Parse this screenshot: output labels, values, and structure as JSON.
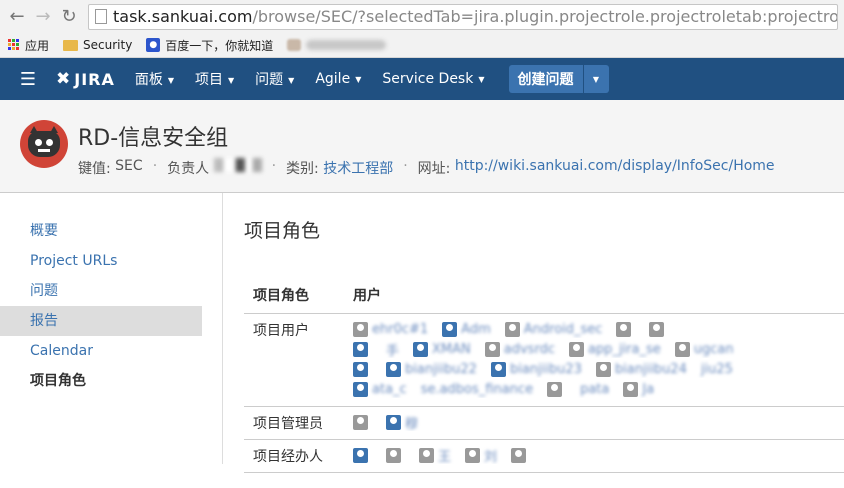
{
  "browser": {
    "url_host": "task.sankuai.com",
    "url_path": "/browse/SEC/?selectedTab=jira.plugin.projectrole.projectroletab:projectroletab",
    "bookmarks": [
      {
        "label": "应用",
        "icon": "apps-icon"
      },
      {
        "label": "Security",
        "icon": "folder-icon"
      },
      {
        "label": "百度一下，你就知道",
        "icon": "baidu-paw-icon"
      }
    ]
  },
  "header": {
    "logo": "JIRA",
    "menu": [
      {
        "label": "面板"
      },
      {
        "label": "项目"
      },
      {
        "label": "问题"
      },
      {
        "label": "Agile"
      },
      {
        "label": "Service Desk"
      }
    ],
    "create_label": "创建问题",
    "brand_color": "#205081"
  },
  "project": {
    "title": "RD-信息安全组",
    "key_label": "键值:",
    "key": "SEC",
    "lead_label": "负责人",
    "category_label": "类别:",
    "category": "技术工程部",
    "url_label": "网址:",
    "url": "http://wiki.sankuai.com/display/InfoSec/Home"
  },
  "sidebar": {
    "items": [
      {
        "label": "概要"
      },
      {
        "label": "Project URLs"
      },
      {
        "label": "问题"
      },
      {
        "label": "报告"
      },
      {
        "label": "Calendar"
      },
      {
        "label": "项目角色"
      }
    ]
  },
  "main": {
    "title": "项目角色",
    "col_role": "项目角色",
    "col_users": "用户",
    "rows": [
      {
        "role": "项目用户",
        "user_lines": [
          [
            "ehr0c#1",
            "Adm",
            "Android_sec",
            "",
            ""
          ],
          [
            "",
            "手",
            "XMAN",
            "advsrdc",
            "app_jira_se",
            "ugcan"
          ],
          [
            "",
            "bianjiibu22",
            "bianjiibu23",
            "bianjiibu24",
            "jiu25"
          ],
          [
            "ata_c",
            "se.adbos_finance",
            "",
            "pata",
            "Ja"
          ]
        ]
      },
      {
        "role": "项目管理员",
        "user_lines": [
          [
            "",
            "穆"
          ]
        ]
      },
      {
        "role": "项目经办人",
        "user_lines": [
          [
            "",
            "",
            "王",
            "刘",
            ""
          ]
        ]
      }
    ]
  }
}
